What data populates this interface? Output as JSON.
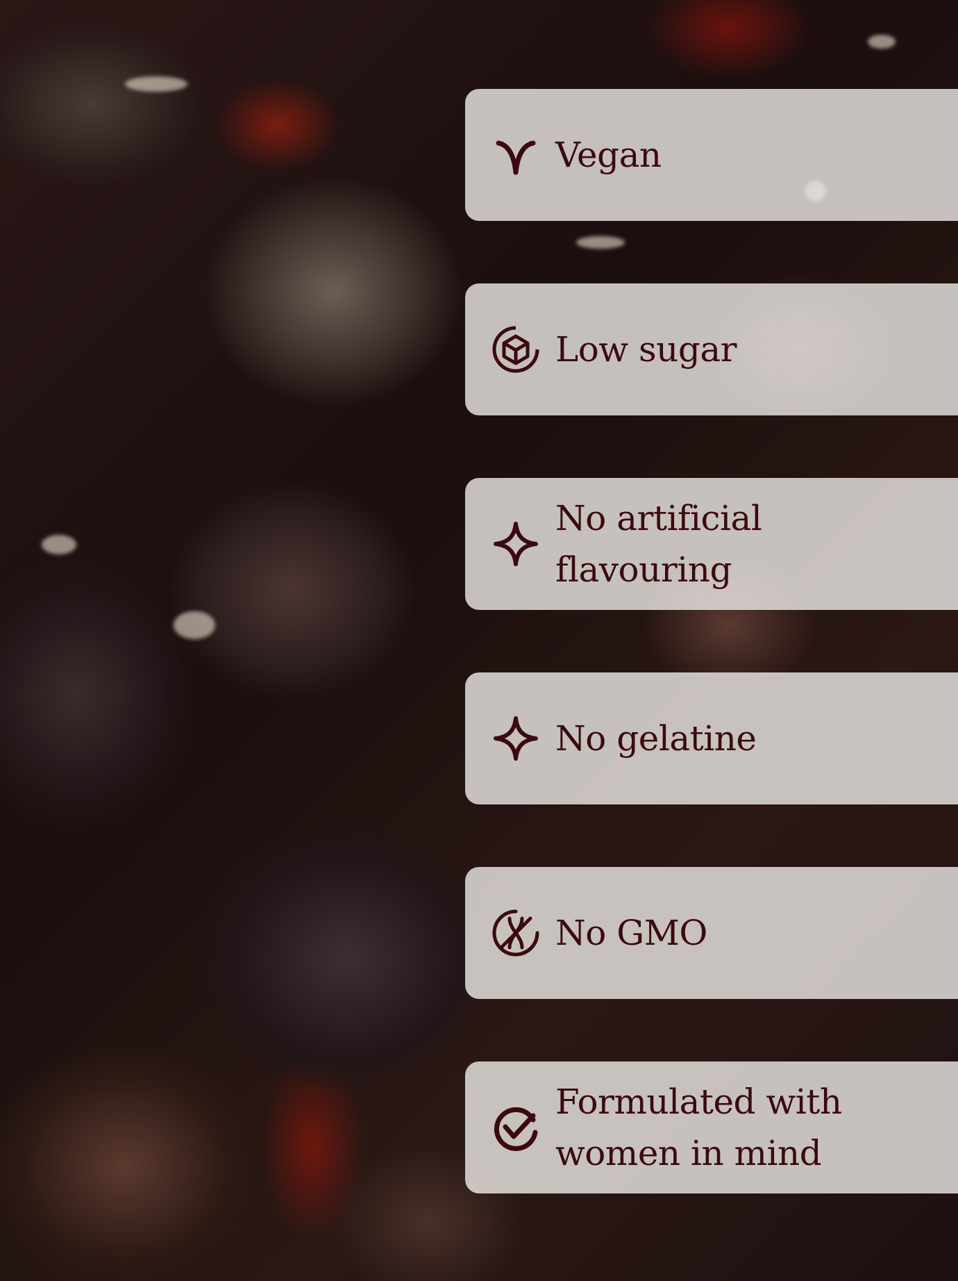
{
  "colors": {
    "text": "#3a0a10",
    "card_background": "rgba(236,232,228,0.82)"
  },
  "background": {
    "description_icon": "gummy-hearts-photo"
  },
  "benefits": [
    {
      "icon": "vegan-icon",
      "label": "Vegan"
    },
    {
      "icon": "low-sugar-icon",
      "label": "Low sugar"
    },
    {
      "icon": "sparkle-icon",
      "label": "No artificial\nflavouring"
    },
    {
      "icon": "sparkle-icon",
      "label": "No gelatine"
    },
    {
      "icon": "no-gmo-icon",
      "label": "No GMO"
    },
    {
      "icon": "check-circle-icon",
      "label": "Formulated with\nwomen in mind"
    }
  ]
}
